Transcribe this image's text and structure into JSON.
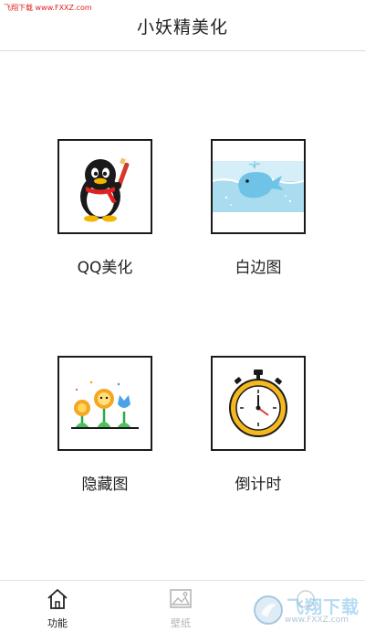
{
  "watermark": {
    "top_text": "飞翔下载 www.FXXZ.com",
    "logo_text": "飞翔下载",
    "logo_url": "www.FXXZ.com"
  },
  "header": {
    "title": "小妖精美化"
  },
  "tiles": [
    {
      "label": "QQ美化",
      "icon": "qq-penguin-icon"
    },
    {
      "label": "白边图",
      "icon": "whale-icon"
    },
    {
      "label": "隐藏图",
      "icon": "flowers-icon"
    },
    {
      "label": "倒计时",
      "icon": "stopwatch-icon"
    }
  ],
  "tabs": [
    {
      "label": "功能",
      "icon": "home-icon",
      "active": true
    },
    {
      "label": "壁纸",
      "icon": "image-icon",
      "active": false
    },
    {
      "label": "",
      "icon": "more-icon",
      "active": false
    }
  ],
  "colors": {
    "title": "#222222",
    "tab_active": "#222222",
    "tab_inactive": "#b5b5b5",
    "watermark_red": "#e02020"
  }
}
